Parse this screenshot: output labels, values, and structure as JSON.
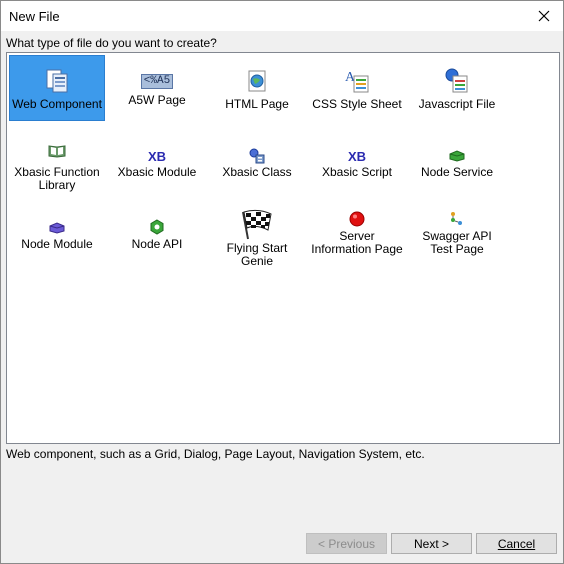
{
  "window": {
    "title": "New File"
  },
  "prompt": "What type of file do you want to create?",
  "items": [
    {
      "label": "Web Component",
      "icon": "web-component-icon",
      "selected": true
    },
    {
      "label": "A5W Page",
      "icon": "a5w-page-icon",
      "icon_text": "<%A5"
    },
    {
      "label": "HTML Page",
      "icon": "html-page-icon"
    },
    {
      "label": "CSS Style Sheet",
      "icon": "css-style-sheet-icon"
    },
    {
      "label": "Javascript File",
      "icon": "javascript-file-icon"
    },
    {
      "label": "Xbasic Function Library",
      "icon": "xbasic-function-library-icon"
    },
    {
      "label": "Xbasic Module",
      "icon": "xbasic-module-icon",
      "icon_text": "XB"
    },
    {
      "label": "Xbasic Class",
      "icon": "xbasic-class-icon"
    },
    {
      "label": "Xbasic Script",
      "icon": "xbasic-script-icon",
      "icon_text": "XB"
    },
    {
      "label": "Node Service",
      "icon": "node-service-icon"
    },
    {
      "label": "Node Module",
      "icon": "node-module-icon"
    },
    {
      "label": "Node API",
      "icon": "node-api-icon"
    },
    {
      "label": "Flying Start Genie",
      "icon": "checkered-flag-icon"
    },
    {
      "label": "Server Information Page",
      "icon": "red-circle-icon"
    },
    {
      "label": "Swagger API Test Page",
      "icon": "swagger-api-icon"
    }
  ],
  "description": "Web component, such as a Grid, Dialog, Page Layout, Navigation System, etc.",
  "buttons": {
    "previous": "< Previous",
    "next": "Next >",
    "cancel": "Cancel"
  },
  "colors": {
    "selection": "#3d9aeb",
    "xb": "#2b2bb0",
    "node_green": "#3aa63a",
    "red": "#e01010"
  }
}
